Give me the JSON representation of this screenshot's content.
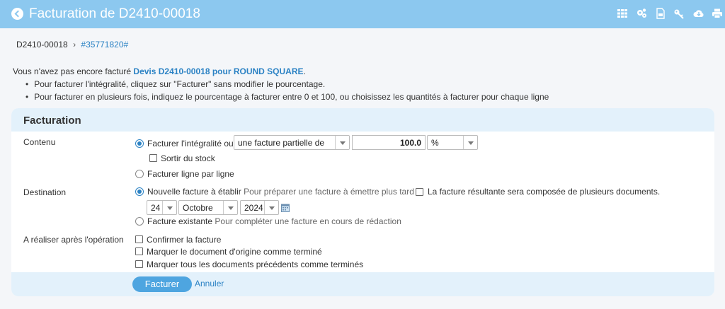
{
  "header": {
    "title": "Facturation de D2410-00018"
  },
  "breadcrumb": {
    "ref": "D2410-00018",
    "separator": "›",
    "link": "#35771820#"
  },
  "notice": {
    "intro": "Vous n'avez pas encore facturé",
    "document": "Devis D2410-00018 pour ROUND SQUARE",
    "intro_end": ".",
    "bullets": [
      "Pour facturer l'intégralité, cliquez sur \"Facturer\" sans modifier le pourcentage.",
      "Pour facturer en plusieurs fois, indiquez le pourcentage à facturer entre 0 et 100, ou choisissez les quantités à facturer pour chaque ligne"
    ]
  },
  "panel": {
    "title": "Facturation",
    "contenu": {
      "label": "Contenu",
      "option_full": "Facturer l'intégralité ou",
      "partial_select": "une facture partielle de",
      "percent_value": "100.0",
      "unit_select": "%",
      "stock_label": "Sortir du stock",
      "option_lines": "Facturer ligne par ligne"
    },
    "destination": {
      "label": "Destination",
      "new_invoice": "Nouvelle facture à établir",
      "new_invoice_hint": "Pour préparer une facture à émettre plus tard",
      "multi_docs": "La facture résultante sera composée de plusieurs documents.",
      "day": "24",
      "month": "Octobre",
      "year": "2024",
      "existing": "Facture existante",
      "existing_hint": "Pour compléter une facture en cours de rédaction"
    },
    "after": {
      "label": "A réaliser après l'opération",
      "options": [
        "Confirmer la facture",
        "Marquer le document d'origine comme terminé",
        "Marquer tous les documents précédents comme terminés"
      ]
    },
    "actions": {
      "submit": "Facturer",
      "cancel": "Annuler"
    }
  },
  "colors": {
    "topbar": "#8cc8ef",
    "accent": "#2b82c4",
    "button": "#4ea5e0",
    "panel_header": "#e3f1fb"
  },
  "icons": [
    "back-icon",
    "grid-icon",
    "settings-icon",
    "pdf-icon",
    "key-icon",
    "download-icon",
    "print-icon",
    "calendar-icon"
  ]
}
